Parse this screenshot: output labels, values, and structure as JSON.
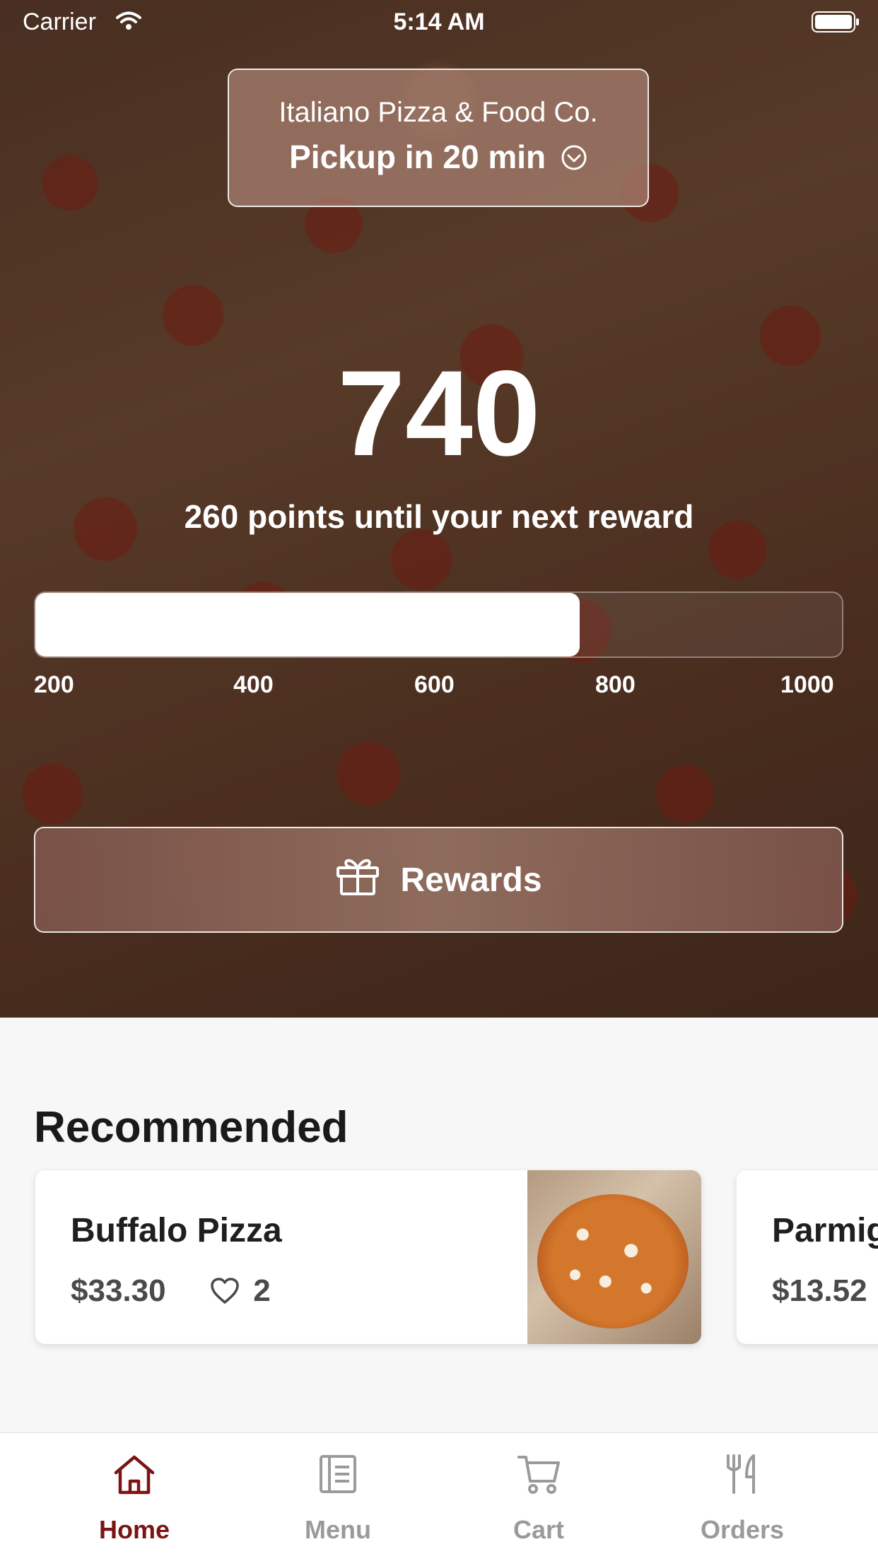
{
  "status_bar": {
    "carrier": "Carrier",
    "time": "5:14 AM"
  },
  "store": {
    "name": "Italiano Pizza & Food Co.",
    "pickup": "Pickup in 20 min"
  },
  "rewards": {
    "points": "740",
    "subtitle": "260 points until your next reward",
    "progress_value": 740,
    "progress_min": 200,
    "progress_max": 1000,
    "ticks": [
      "200",
      "400",
      "600",
      "800",
      "1000"
    ],
    "button_label": "Rewards"
  },
  "recommended": {
    "title": "Recommended",
    "items": [
      {
        "name": "Buffalo Pizza",
        "price": "$33.30",
        "likes": "2"
      },
      {
        "name": "Parmig",
        "price": "$13.52"
      }
    ]
  },
  "tabs": [
    {
      "label": "Home",
      "icon": "home-icon",
      "active": true
    },
    {
      "label": "Menu",
      "icon": "menu-icon",
      "active": false
    },
    {
      "label": "Cart",
      "icon": "cart-icon",
      "active": false
    },
    {
      "label": "Orders",
      "icon": "fork-knife-icon",
      "active": false
    }
  ],
  "colors": {
    "accent": "#7b1414",
    "inactive_tab": "#9a9a9a"
  }
}
